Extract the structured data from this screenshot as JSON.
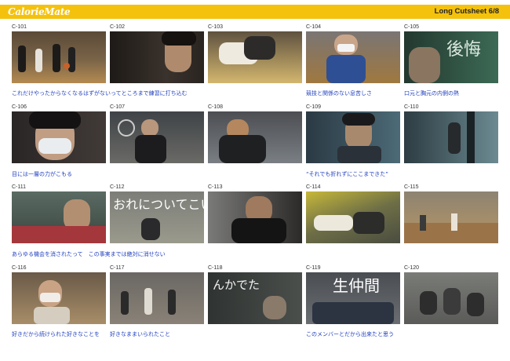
{
  "header": {
    "logo": "CalorieMate",
    "title": "Long Cutsheet 6/8",
    "color": "#f4c20d"
  },
  "cuts": [
    {
      "id": "C-101",
      "bg": "#6b5a45"
    },
    {
      "id": "C-102",
      "bg": "#2b2622"
    },
    {
      "id": "C-103",
      "bg": "#8a7658"
    },
    {
      "id": "C-104",
      "bg": "#6e6a6a"
    },
    {
      "id": "C-105",
      "bg": "#294a3c"
    },
    {
      "id": "C-106",
      "bg": "#2f2b2b"
    },
    {
      "id": "C-107",
      "bg": "#4b4f55"
    },
    {
      "id": "C-108",
      "bg": "#5a5b5e"
    },
    {
      "id": "C-109",
      "bg": "#3a4a54"
    },
    {
      "id": "C-110",
      "bg": "#3e4f56"
    },
    {
      "id": "C-111",
      "bg": "#4f5f5a"
    },
    {
      "id": "C-112",
      "bg": "#6d6e68"
    },
    {
      "id": "C-113",
      "bg": "#3c3a38"
    },
    {
      "id": "C-114",
      "bg": "#6a6d42"
    },
    {
      "id": "C-115",
      "bg": "#786f5f"
    },
    {
      "id": "C-116",
      "bg": "#7a6a55"
    },
    {
      "id": "C-117",
      "bg": "#5d5a55"
    },
    {
      "id": "C-118",
      "bg": "#3b3f3d"
    },
    {
      "id": "C-119",
      "bg": "#4a4d52"
    },
    {
      "id": "C-120",
      "bg": "#6f716e"
    }
  ],
  "captions": [
    {
      "text": "これだけやったからなくなるはずがないってところまで練習に打ち込む"
    },
    {
      "text": "競技と関係のない息苦しさ"
    },
    {
      "text": "口元と胸元の内側の熱"
    },
    {
      "text": "目には一層の力がこもる"
    },
    {
      "text": "“それでも折れずにここまできた”"
    },
    {
      "text": "あらゆる機会を消されたって　この事実までは絶対に消せない"
    },
    {
      "text": "好きだから続けられた好きなことを"
    },
    {
      "text": "好きなままいられたこと"
    },
    {
      "text": "このメンバーとだから出来たと思う"
    }
  ],
  "overlay_text": {
    "c105": "後悔",
    "c112": "おれについてこい",
    "c118": "んかでた",
    "c119": "生仲間"
  }
}
